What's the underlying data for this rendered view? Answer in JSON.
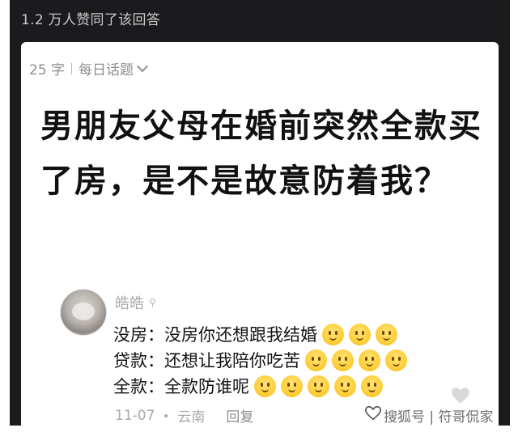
{
  "header": {
    "likes_text": "1.2 万人赞同了该回答"
  },
  "card": {
    "word_count": "25 字",
    "topic": "每日话题",
    "question": "男朋友父母在婚前突然全款买了房，是不是故意防着我？"
  },
  "comment": {
    "username": "皓皓",
    "username_badge": "⚲",
    "lines": [
      {
        "text": "没房：没房你还想跟我结婚",
        "emoji_count": 3
      },
      {
        "text": "贷款：还想让我陪你吃苦",
        "emoji_count": 4
      },
      {
        "text": "全款：全款防谁呢",
        "emoji_count": 5
      }
    ],
    "date": "11-07",
    "location": "云南",
    "reply_label": "回复"
  },
  "watermark": {
    "text": "搜狐号 | 符哥侃家具"
  },
  "colors": {
    "frame_bg": "#1b1b1d",
    "emoji_yellow": "#ffcf3a"
  }
}
